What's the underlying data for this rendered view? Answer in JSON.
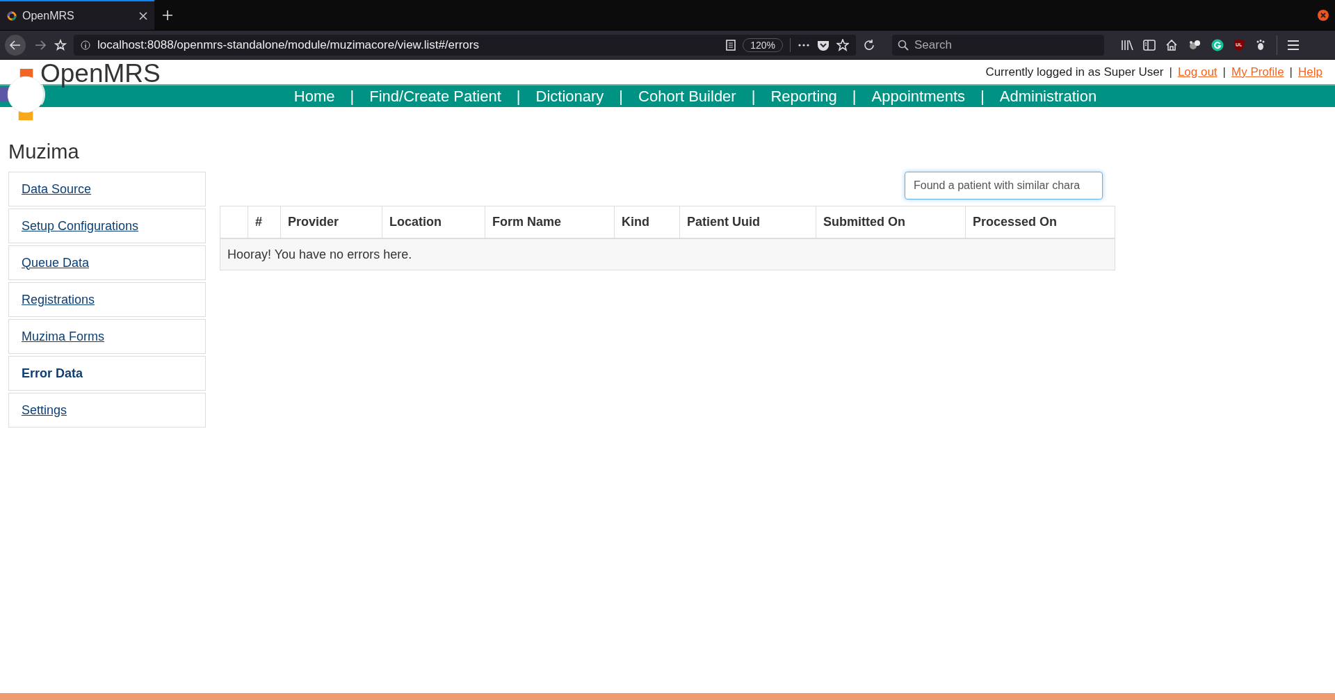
{
  "browser": {
    "tab": {
      "title": "OpenMRS",
      "selected": true
    },
    "url": "localhost:8088/openmrs-standalone/module/muzimacore/view.list#/errors",
    "zoom": "120%",
    "search": {
      "placeholder": "Search"
    }
  },
  "header": {
    "logo_text": "OpenMRS",
    "user_text": "Currently logged in as Super User",
    "separator": "|",
    "user_links": [
      "Log out",
      "My Profile",
      "Help"
    ]
  },
  "nav": {
    "separator": "|",
    "items": [
      "Home",
      "Find/Create Patient",
      "Dictionary",
      "Cohort Builder",
      "Reporting",
      "Appointments",
      "Administration"
    ]
  },
  "page_title": "Muzima",
  "sidebar": {
    "items": [
      {
        "label": "Data Source",
        "selected": false
      },
      {
        "label": "Setup Configurations",
        "selected": false
      },
      {
        "label": "Queue Data",
        "selected": false
      },
      {
        "label": "Registrations",
        "selected": false
      },
      {
        "label": "Muzima Forms",
        "selected": false
      },
      {
        "label": "Error Data",
        "selected": true
      },
      {
        "label": "Settings",
        "selected": false
      }
    ]
  },
  "filter": {
    "value": "Found a patient with similar chara"
  },
  "table": {
    "columns": [
      "#",
      "Provider",
      "Location",
      "Form Name",
      "Kind",
      "Patient Uuid",
      "Submitted On",
      "Processed On"
    ],
    "empty_message": "Hooray! You have no errors here."
  }
}
